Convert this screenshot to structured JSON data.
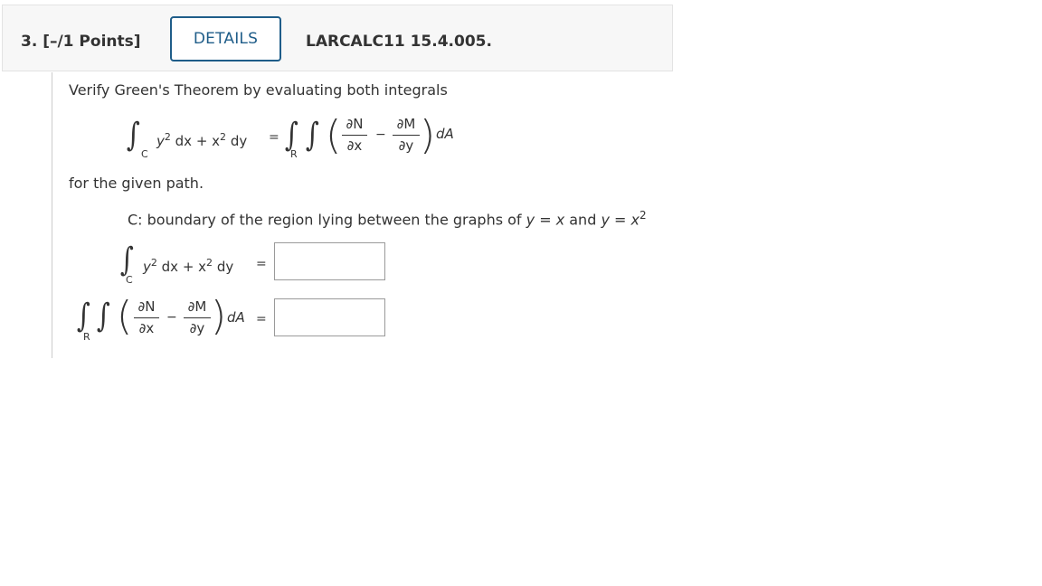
{
  "header": {
    "question_number": "3. [–/1 Points]",
    "details_label": "DETAILS",
    "question_code": "LARCALC11 15.4.005."
  },
  "prompt": {
    "intro": "Verify Green's Theorem by evaluating both integrals",
    "after": "for the given path.",
    "path_prefix": "C: boundary of the region lying between the graphs of",
    "path_eq1": "y = x",
    "path_and": "and",
    "path_eq2": "y = x",
    "path_exp": "2"
  },
  "formula": {
    "line_integrand_y": "y",
    "line_integrand_exp1": "2",
    "line_integrand_dx": " dx + x",
    "line_integrand_exp2": "2",
    "line_integrand_dy": " dy",
    "equals": "=",
    "sub_c": "C",
    "sub_r": "R",
    "partial_n": "∂N",
    "partial_x": "∂x",
    "partial_m": "∂M",
    "partial_y": "∂y",
    "minus": "−",
    "da": "dA"
  },
  "answers": {
    "line_integral_value": "",
    "double_integral_value": ""
  }
}
